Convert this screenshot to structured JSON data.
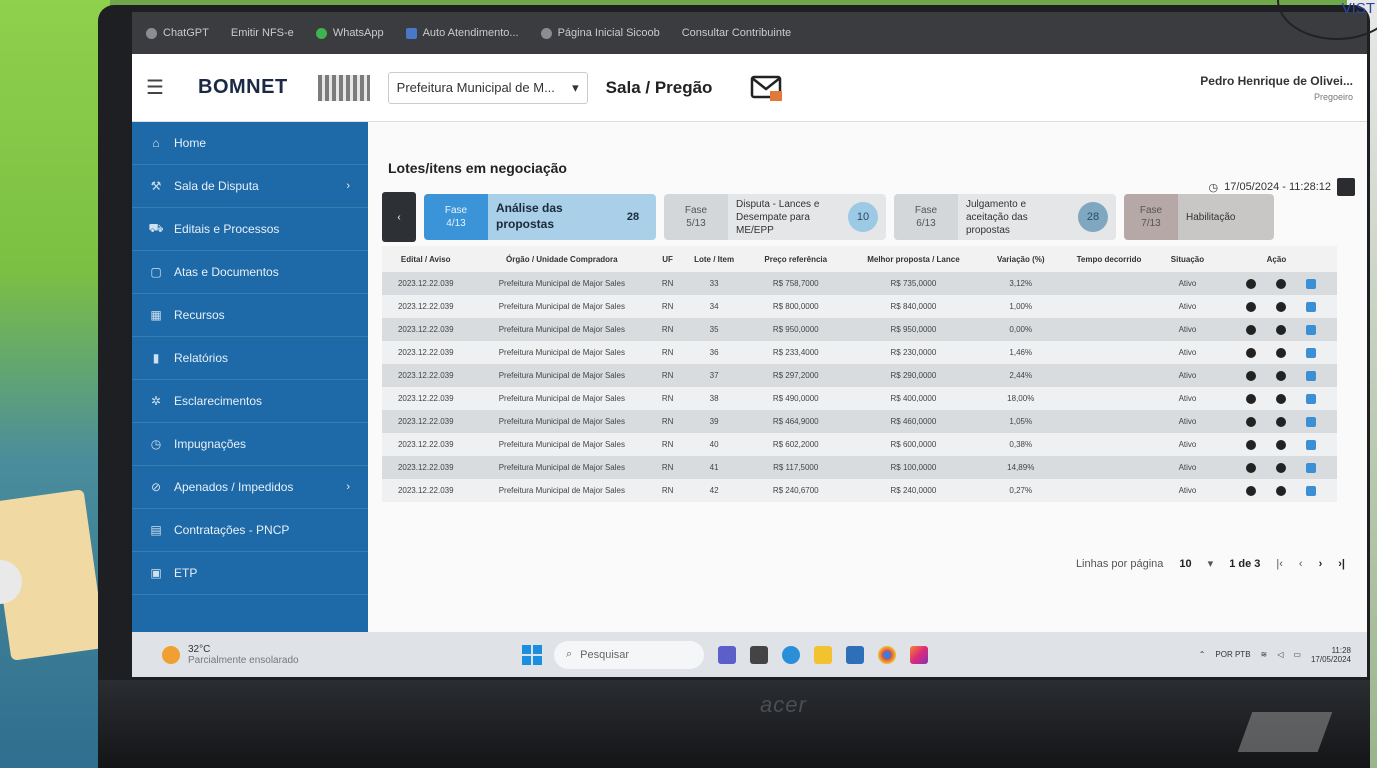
{
  "browser": {
    "bookmarks": [
      {
        "label": "ChatGPT",
        "icon": "chatgpt-icon"
      },
      {
        "label": "Emitir NFS-e",
        "icon": "link-icon"
      },
      {
        "label": "WhatsApp",
        "icon": "whatsapp-icon"
      },
      {
        "label": "Auto Atendimento...",
        "icon": "bank-icon"
      },
      {
        "label": "Página Inicial Sicoob",
        "icon": "globe-icon"
      },
      {
        "label": "Consultar Contribuinte",
        "icon": "link-icon"
      }
    ]
  },
  "header": {
    "brand": "BOMNET",
    "org_select": "Prefeitura Municipal de M...",
    "page_heading": "Sala / Pregão",
    "user_name": "Pedro Henrique de Olivei...",
    "user_role": "Pregoeiro"
  },
  "sidebar": {
    "items": [
      {
        "label": "Home",
        "icon": "home-icon",
        "arrow": ""
      },
      {
        "label": "Sala de Disputa",
        "icon": "gavel-icon",
        "arrow": "›"
      },
      {
        "label": "Editais e Processos",
        "icon": "cart-icon",
        "arrow": ""
      },
      {
        "label": "Atas e Documentos",
        "icon": "document-icon",
        "arrow": ""
      },
      {
        "label": "Recursos",
        "icon": "calendar-icon",
        "arrow": ""
      },
      {
        "label": "Relatórios",
        "icon": "bar-chart-icon",
        "arrow": ""
      },
      {
        "label": "Esclarecimentos",
        "icon": "gear-icon",
        "arrow": ""
      },
      {
        "label": "Impugnações",
        "icon": "clock-icon",
        "arrow": ""
      },
      {
        "label": "Apenados / Impedidos",
        "icon": "ban-icon",
        "arrow": "›"
      },
      {
        "label": "Contratações - PNCP",
        "icon": "contract-icon",
        "arrow": ""
      },
      {
        "label": "ETP",
        "icon": "file-icon",
        "arrow": ""
      }
    ]
  },
  "main": {
    "title": "Lotes/itens em negociação",
    "timestamp": "17/05/2024 - 11:28:12",
    "phase_prev": "‹",
    "phases": [
      {
        "fase_label": "Fase",
        "fase_num": "4/13",
        "desc": "Análise das propostas",
        "count": "28",
        "state": "active"
      },
      {
        "fase_label": "Fase",
        "fase_num": "5/13",
        "desc": "Disputa - Lances e Desempate para ME/EPP",
        "count": "10",
        "state": "normal"
      },
      {
        "fase_label": "Fase",
        "fase_num": "6/13",
        "desc": "Julgamento e aceitação das propostas",
        "count": "28",
        "state": "normal"
      },
      {
        "fase_label": "Fase",
        "fase_num": "7/13",
        "desc": "Habilitação",
        "count": "",
        "state": "dim"
      }
    ],
    "table": {
      "headers": [
        "Edital / Aviso",
        "Órgão / Unidade Compradora",
        "UF",
        "Lote / Item",
        "Preço referência",
        "Melhor proposta / Lance",
        "Variação (%)",
        "Tempo decorrido",
        "Situação",
        "Ação"
      ],
      "rows": [
        [
          "2023.12.22.039",
          "Prefeitura Municipal de Major Sales",
          "RN",
          "33",
          "R$ 758,7000",
          "R$ 735,0000",
          "3,12%",
          "",
          "Ativo"
        ],
        [
          "2023.12.22.039",
          "Prefeitura Municipal de Major Sales",
          "RN",
          "34",
          "R$ 800,0000",
          "R$ 840,0000",
          "1,00%",
          "",
          "Ativo"
        ],
        [
          "2023.12.22.039",
          "Prefeitura Municipal de Major Sales",
          "RN",
          "35",
          "R$ 950,0000",
          "R$ 950,0000",
          "0,00%",
          "",
          "Ativo"
        ],
        [
          "2023.12.22.039",
          "Prefeitura Municipal de Major Sales",
          "RN",
          "36",
          "R$ 233,4000",
          "R$ 230,0000",
          "1,46%",
          "",
          "Ativo"
        ],
        [
          "2023.12.22.039",
          "Prefeitura Municipal de Major Sales",
          "RN",
          "37",
          "R$ 297,2000",
          "R$ 290,0000",
          "2,44%",
          "",
          "Ativo"
        ],
        [
          "2023.12.22.039",
          "Prefeitura Municipal de Major Sales",
          "RN",
          "38",
          "R$ 490,0000",
          "R$ 400,0000",
          "18,00%",
          "",
          "Ativo"
        ],
        [
          "2023.12.22.039",
          "Prefeitura Municipal de Major Sales",
          "RN",
          "39",
          "R$ 464,9000",
          "R$ 460,0000",
          "1,05%",
          "",
          "Ativo"
        ],
        [
          "2023.12.22.039",
          "Prefeitura Municipal de Major Sales",
          "RN",
          "40",
          "R$ 602,2000",
          "R$ 600,0000",
          "0,38%",
          "",
          "Ativo"
        ],
        [
          "2023.12.22.039",
          "Prefeitura Municipal de Major Sales",
          "RN",
          "41",
          "R$ 117,5000",
          "R$ 100,0000",
          "14,89%",
          "",
          "Ativo"
        ],
        [
          "2023.12.22.039",
          "Prefeitura Municipal de Major Sales",
          "RN",
          "42",
          "R$ 240,6700",
          "R$ 240,0000",
          "0,27%",
          "",
          "Ativo"
        ]
      ]
    },
    "pager": {
      "label": "Linhas por página",
      "per_page": "10",
      "range": "1 de 3",
      "first": "|‹",
      "prev": "‹",
      "next": "›",
      "last": "›|"
    }
  },
  "taskbar": {
    "temperature": "32°C",
    "weather": "Parcialmente ensolarado",
    "search_placeholder": "Pesquisar",
    "lang": "POR PTB",
    "time": "11:28",
    "date": "17/05/2024"
  },
  "colors": {
    "sidebar": "#1e6aa8",
    "phase_active": "#3b93d8",
    "table_odd": "#d9dcdf"
  }
}
